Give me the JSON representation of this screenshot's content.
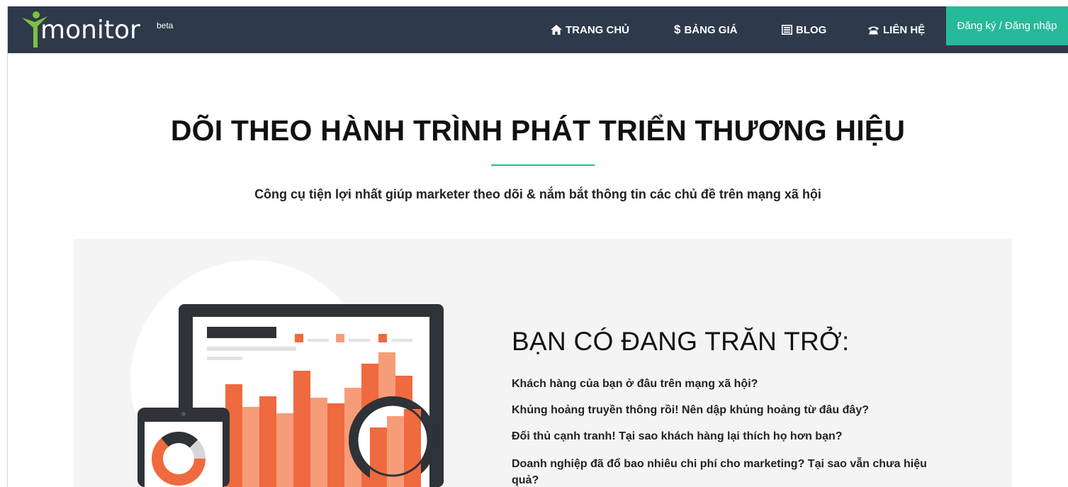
{
  "brand": {
    "logo_text": "monitor",
    "badge": "beta"
  },
  "nav": {
    "items": [
      {
        "label": "TRANG CHỦ",
        "icon": "home-icon"
      },
      {
        "label": "BẢNG GIÁ",
        "icon": "dollar-icon"
      },
      {
        "label": "BLOG",
        "icon": "newspaper-icon"
      },
      {
        "label": "LIÊN HỆ",
        "icon": "phone-icon"
      }
    ],
    "price_symbol": "$",
    "cta_label": "Đăng ký / Đăng nhập"
  },
  "hero": {
    "title": "DÕI THEO HÀNH TRÌNH PHÁT TRIỂN THƯƠNG HIỆU",
    "subtitle": "Công cụ tiện lợi nhất giúp marketer theo dõi & nắm bắt thông tin các chủ đề trên mạng xã hội"
  },
  "panel": {
    "title": "BẠN CÓ ĐANG TRĂN TRỞ:",
    "questions": [
      "Khách hàng của bạn ở đâu trên mạng xã hội?",
      "Khủng hoảng truyền thông rồi! Nên dập khủng hoảng từ đâu đây?",
      "Đối thủ cạnh tranh! Tại sao khách hàng lại thích họ hơn bạn?",
      "Doanh nghiệp đã đổ bao nhiêu chi phí cho marketing? Tại sao vẫn chưa hiệu quả?"
    ]
  },
  "colors": {
    "navbar": "#2e3a4b",
    "accent": "#26b99a",
    "logo_green": "#7cc142",
    "panel_bg": "#f4f4f4",
    "bar_orange": "#ef6a3e",
    "bar_light": "#f79c79",
    "device_dark": "#2f3237"
  }
}
